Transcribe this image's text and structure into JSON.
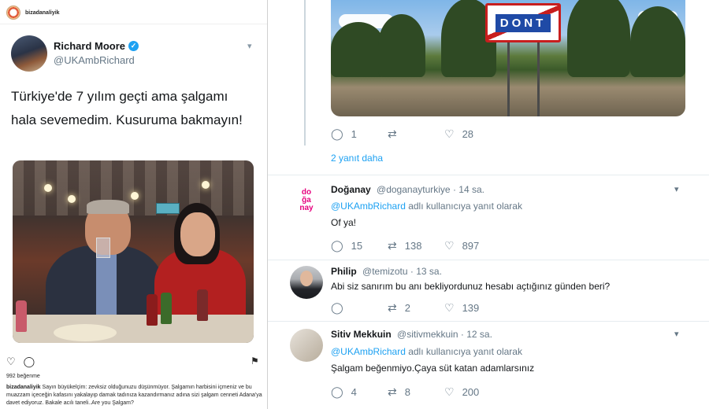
{
  "instagram": {
    "username": "bizadanaliyik",
    "likes": "992 beğenme",
    "caption_user": "bizadanaliyik",
    "caption_text": "Sayın büyükelçim: zevksiz olduğunuzu düşünmüyor. Şalgamın harbisini içmeniz ve bu muazzam içeceğin kafasını yakalayıp damak tadınıza kazandırmanız adına sizi şalgam cenneti Adana'ya davet ediyoruz. Bakale acılı taneli..Are you Şalgam?",
    "icons": [
      "heart-icon",
      "comment-icon",
      "bookmark-icon"
    ]
  },
  "embedded_tweet": {
    "name": "Richard Moore",
    "handle": "@UKAmbRichard",
    "verified": true,
    "text": "Türkiye'de 7 yılım geçti ama şalgamı hala sevemedim. Kusuruma bakmayın!"
  },
  "thread_top": {
    "image_sign_text": "DONT",
    "actions": {
      "replies": "1",
      "retweets": "",
      "likes": "28"
    },
    "more_replies": "2 yanıt daha"
  },
  "replies": [
    {
      "name": "Doğanay",
      "handle": "@doganayturkiye",
      "time": "· 14 sa.",
      "replying_to_link": "@UKAmbRichard",
      "replying_to_suffix": " adlı kullanıcıya yanıt olarak",
      "text": "Of ya!",
      "actions": {
        "replies": "15",
        "retweets": "138",
        "likes": "897"
      },
      "avatar_text": [
        "do",
        "ğa",
        "nay"
      ]
    },
    {
      "name": "Philip",
      "handle": "@temizotu",
      "time": "· 13 sa.",
      "text": "Abi siz sanırım bu anı bekliyordunuz hesabı açtığınız günden beri?",
      "actions": {
        "replies": "",
        "retweets": "2",
        "likes": "139"
      }
    },
    {
      "name": "Sitiv Mekkuin",
      "handle": "@sitivmekkuin",
      "time": "· 12 sa.",
      "replying_to_link": "@UKAmbRichard",
      "replying_to_suffix": " adlı kullanıcıya yanıt olarak",
      "text": "Şalgam beğenmiyo.Çaya süt katan adamlarsınız",
      "actions": {
        "replies": "4",
        "retweets": "8",
        "likes": "200"
      }
    }
  ],
  "colors": {
    "twitter_blue": "#1da1f2",
    "muted": "#657786",
    "text": "#14171a",
    "doganay_pink": "#e6007e"
  }
}
